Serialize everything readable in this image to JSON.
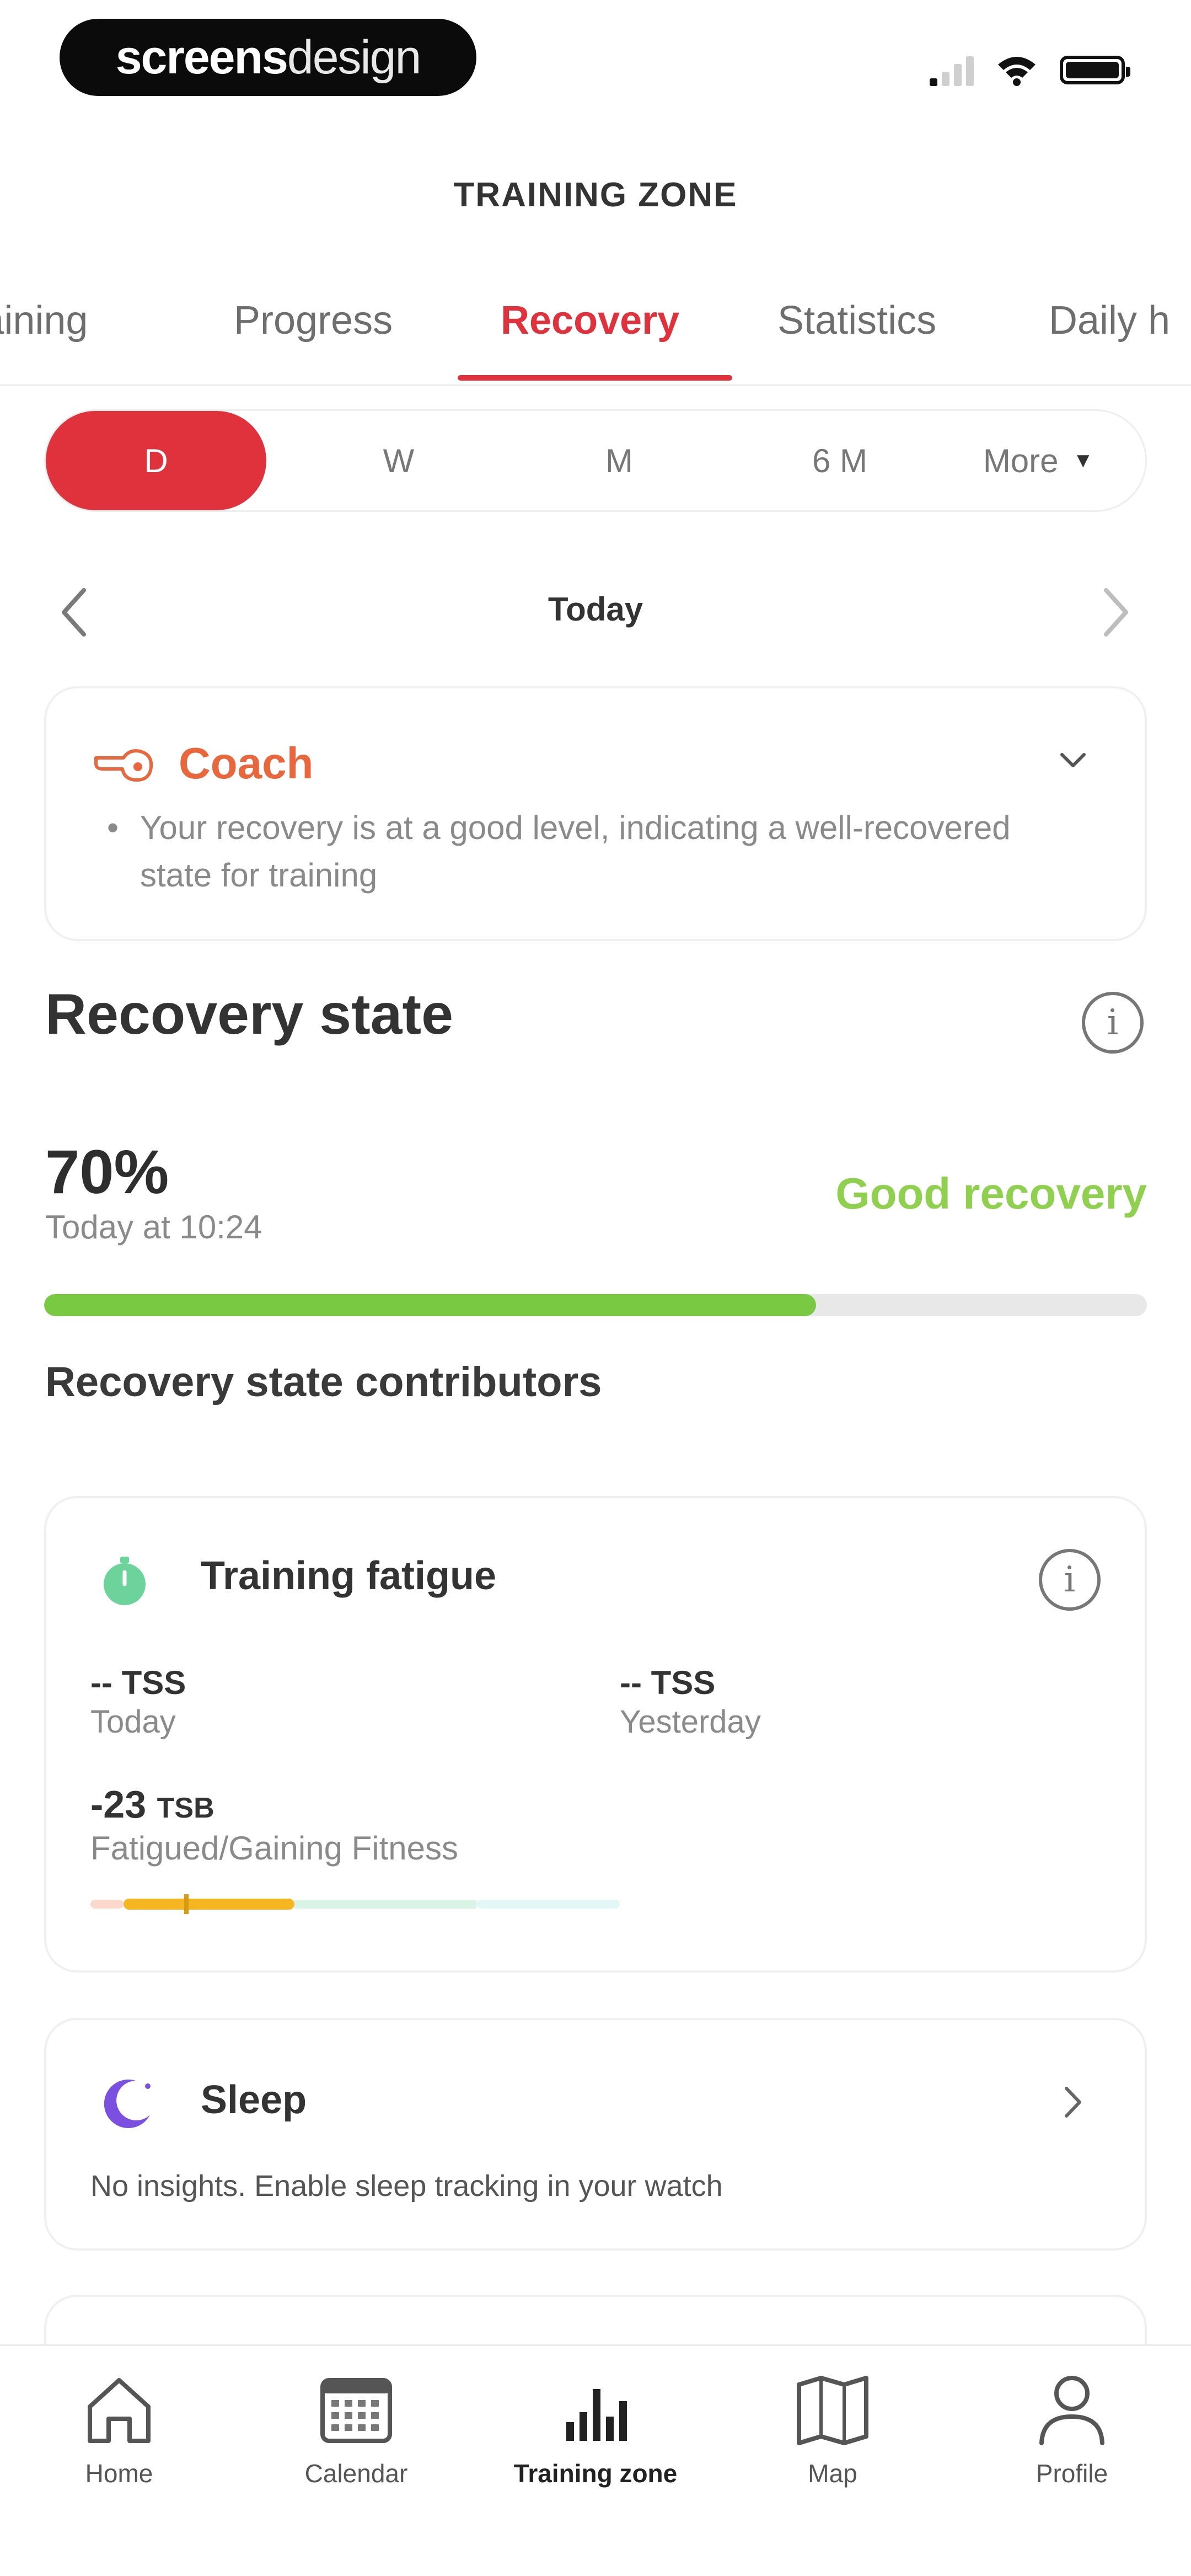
{
  "status_bar": {
    "brand_bold": "screens",
    "brand_light": "design",
    "icons": [
      "signal-icon",
      "wifi-icon",
      "battery-icon"
    ]
  },
  "header": {
    "title": "TRAINING ZONE"
  },
  "tabs": [
    {
      "label": "Training",
      "active": false
    },
    {
      "label": "Progress",
      "active": false
    },
    {
      "label": "Recovery",
      "active": true
    },
    {
      "label": "Statistics",
      "active": false
    },
    {
      "label": "Daily h",
      "active": false
    }
  ],
  "period": {
    "options": [
      "D",
      "W",
      "M",
      "6 M",
      "More"
    ],
    "selected": "D"
  },
  "date_nav": {
    "label": "Today"
  },
  "coach": {
    "title": "Coach",
    "text": "Your recovery is at a good level, indicating a well-recovered state for training"
  },
  "recovery": {
    "title": "Recovery state",
    "value": "70%",
    "progress": 0.7,
    "time": "Today at 10:24",
    "status": "Good recovery",
    "contributors_title": "Recovery state contributors"
  },
  "fatigue": {
    "title": "Training fatigue",
    "today_value": "-- TSS",
    "today_label": "Today",
    "yesterday_value": "-- TSS",
    "yesterday_label": "Yesterday",
    "tsb_value": "-23",
    "tsb_unit": "TSB",
    "tsb_label": "Fatigued/Gaining Fitness"
  },
  "sleep": {
    "title": "Sleep",
    "text": "No insights. Enable sleep tracking in your watch"
  },
  "bottom_nav": [
    {
      "label": "Home",
      "icon": "home-icon",
      "active": false
    },
    {
      "label": "Calendar",
      "icon": "calendar-icon",
      "active": false
    },
    {
      "label": "Training zone",
      "icon": "bar-chart-icon",
      "active": true
    },
    {
      "label": "Map",
      "icon": "map-icon",
      "active": false
    },
    {
      "label": "Profile",
      "icon": "profile-icon",
      "active": false
    }
  ],
  "colors": {
    "accent": "#e0323c",
    "coach": "#e8673c",
    "good": "#8fd14f",
    "progress": "#7ac943",
    "sleep": "#7b4fe0"
  }
}
